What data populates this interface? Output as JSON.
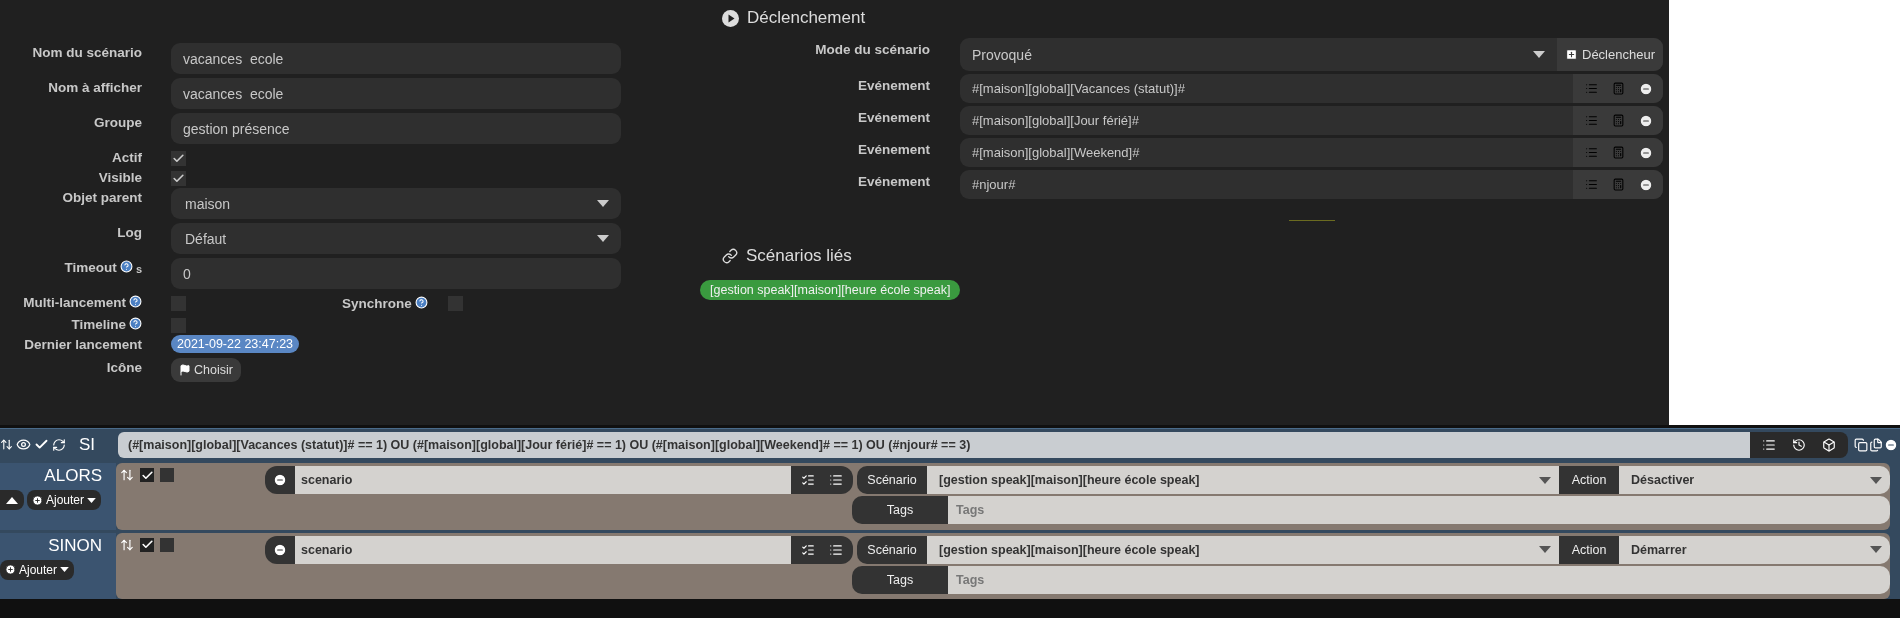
{
  "general": {
    "fields": [
      {
        "kind": "text",
        "label": "Nom du scénario",
        "help": false,
        "value": "vacances  ecole"
      },
      {
        "kind": "text",
        "label": "Nom à afficher",
        "help": false,
        "value": "vacances  ecole"
      },
      {
        "kind": "text",
        "label": "Groupe",
        "help": false,
        "value": "gestion présence"
      },
      {
        "kind": "checkbox",
        "label": "Actif",
        "help": false,
        "checked": true
      },
      {
        "kind": "checkbox",
        "label": "Visible",
        "help": false,
        "checked": true
      },
      {
        "kind": "select",
        "label": "Objet parent",
        "help": false,
        "value": "maison"
      },
      {
        "kind": "select",
        "label": "Log",
        "help": false,
        "value": "Défaut"
      },
      {
        "kind": "text",
        "label": "Timeout",
        "help": true,
        "unit": "s",
        "value": "0"
      },
      {
        "kind": "checkbox",
        "label": "Multi-lancement",
        "help": true,
        "checked": false,
        "extra": {
          "label": "Synchrone",
          "help": true,
          "checked": false
        }
      },
      {
        "kind": "checkbox",
        "label": "Timeline",
        "help": true,
        "checked": false
      },
      {
        "kind": "badge",
        "label": "Dernier lancement",
        "help": false,
        "value": "2021-09-22 23:47:23"
      },
      {
        "kind": "icon_button",
        "label": "Icône",
        "help": false,
        "value": "Choisir"
      }
    ]
  },
  "trigger": {
    "title": "Déclenchement",
    "mode_label": "Mode du scénario",
    "mode": "Provoqué",
    "add_button": "Déclencheur",
    "events": [
      {
        "label": "Evénement",
        "value": "#[maison][global][Vacances (statut)]#"
      },
      {
        "label": "Evénement",
        "value": "#[maison][global][Jour férié]#"
      },
      {
        "label": "Evénement",
        "value": "#[maison][global][Weekend]#"
      },
      {
        "label": "Evénement",
        "value": "#njour#"
      }
    ]
  },
  "linked": {
    "title": "Scénarios liés",
    "items": [
      "[gestion speak][maison][heure école speak]"
    ]
  },
  "condition": {
    "keyword": "SI",
    "expression": "(#[maison][global][Vacances (statut)]# == 1) OU (#[maison][global][Jour férié]# == 1) OU (#[maison][global][Weekend]# == 1) OU (#njour# == 3)"
  },
  "blocks": [
    {
      "keyword": "ALORS",
      "move_up": true,
      "add_button": "Ajouter",
      "actions": [
        {
          "enabled": true,
          "parallel": false,
          "expression": "scenario",
          "scenario_label": "Scénario",
          "scenario": "[gestion speak][maison][heure école speak]",
          "action_label": "Action",
          "action": "Désactiver",
          "tags_label": "Tags",
          "tags_placeholder": "Tags"
        }
      ]
    },
    {
      "keyword": "SINON",
      "move_up": false,
      "add_button": "Ajouter",
      "actions": [
        {
          "enabled": true,
          "parallel": false,
          "expression": "scenario",
          "scenario_label": "Scénario",
          "scenario": "[gestion speak][maison][heure école speak]",
          "action_label": "Action",
          "action": "Démarrer",
          "tags_label": "Tags",
          "tags_placeholder": "Tags"
        }
      ]
    }
  ]
}
